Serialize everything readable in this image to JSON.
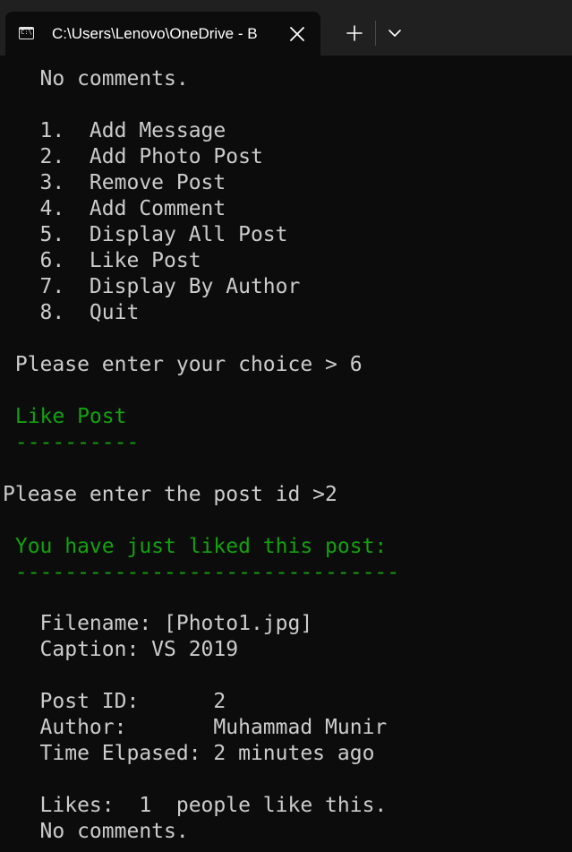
{
  "window": {
    "tab_title": "C:\\Users\\Lenovo\\OneDrive - B",
    "tab_icon_text": "C:\\",
    "colors": {
      "background": "#0c0c0c",
      "tabbar": "#202020",
      "text": "#cccccc",
      "heading_green": "#13a10e"
    }
  },
  "console": {
    "top_no_comments": "   No comments.",
    "menu": [
      "   1.  Add Message",
      "   2.  Add Photo Post",
      "   3.  Remove Post",
      "   4.  Add Comment",
      "   5.  Display All Post",
      "   6.  Like Post",
      "   7.  Display By Author",
      "   8.  Quit"
    ],
    "choice_prompt": " Please enter your choice > 6",
    "like_heading": " Like Post",
    "like_underline": " ----------",
    "post_id_prompt": "Please enter the post id >2",
    "liked_heading": " You have just liked this post:",
    "liked_underline": " -------------------------------",
    "post": {
      "filename": "   Filename: [Photo1.jpg]",
      "caption": "   Caption: VS 2019",
      "post_id": "   Post ID:      2",
      "author": "   Author:       Muhammad Munir",
      "time_elapsed": "   Time Elpased: 2 minutes ago",
      "likes": "   Likes:  1  people like this.",
      "comments": "   No comments."
    }
  }
}
